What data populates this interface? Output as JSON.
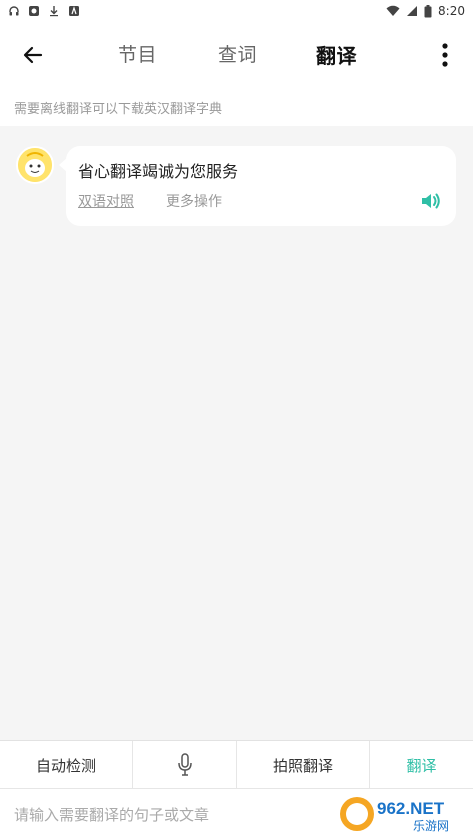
{
  "status_bar": {
    "time": "8:20",
    "left_icons": [
      "headset-icon",
      "app-notification-icon",
      "download-icon",
      "text-notification-icon"
    ],
    "right_icons": [
      "wifi-icon",
      "signal-icon",
      "battery-icon"
    ]
  },
  "header": {
    "tabs": [
      {
        "label": "节目",
        "active": false
      },
      {
        "label": "查词",
        "active": false
      },
      {
        "label": "翻译",
        "active": true
      }
    ],
    "back_icon": "arrow-left-icon",
    "menu_icon": "more-vertical-icon"
  },
  "hint": {
    "text": "需要离线翻译可以下载英汉翻译字典"
  },
  "chat": {
    "messages": [
      {
        "text": "省心翻译竭诚为您服务",
        "actions": [
          "双语对照",
          "更多操作"
        ],
        "speaker_icon": "speaker-icon"
      }
    ]
  },
  "toolbar": {
    "auto_detect": "自动检测",
    "mic_icon": "microphone-icon",
    "photo_translate": "拍照翻译",
    "translate": "翻译",
    "accent_color": "#2fbfa6"
  },
  "input": {
    "placeholder": "请输入需要翻译的句子或文章"
  },
  "watermark": {
    "text": "962.NET",
    "subtext": "乐游网"
  }
}
